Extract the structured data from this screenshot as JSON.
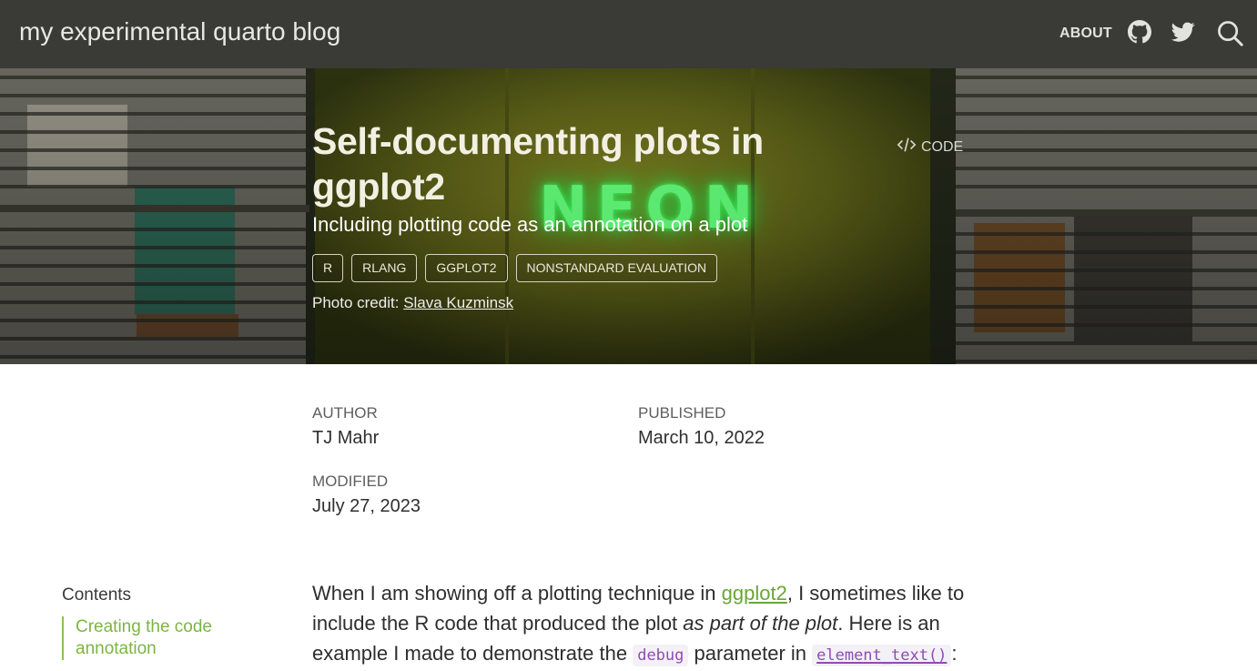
{
  "navbar": {
    "brand": "my experimental quarto blog",
    "about_label": "ABOUT",
    "icons": [
      "github-icon",
      "twitter-icon",
      "search-icon"
    ]
  },
  "hero": {
    "title": "Self-documenting plots in ggplot2",
    "subtitle": "Including plotting code as an annotation on a plot",
    "code_label": "CODE",
    "categories": [
      "R",
      "RLANG",
      "GGPLOT2",
      "NONSTANDARD EVALUATION"
    ],
    "credit_prefix": "Photo credit:",
    "credit_name": "Slava Kuzminsk",
    "sign_text": "NEON"
  },
  "meta": {
    "author_label": "AUTHOR",
    "author": "TJ Mahr",
    "published_label": "PUBLISHED",
    "published": "March 10, 2022",
    "modified_label": "MODIFIED",
    "modified": "July 27, 2023"
  },
  "toc": {
    "title": "Contents",
    "items": [
      "Creating the code annotation"
    ]
  },
  "body": {
    "p1_a": "When I am showing off a plotting technique in ",
    "p1_link": "ggplot2",
    "p1_b": ", I sometimes like to include the R code that produced the plot ",
    "p1_em": "as part of the plot",
    "p1_c": ". Here is an example I made to demonstrate the ",
    "p1_code1": "debug",
    "p1_d": " parameter in ",
    "p1_code2": "element_text()",
    "p1_e": ":"
  },
  "colors": {
    "navbar_bg": "#3a3b36",
    "link_green": "#6aa636",
    "toc_green": "#7bb542",
    "code_purple": "#8e4cb4"
  }
}
